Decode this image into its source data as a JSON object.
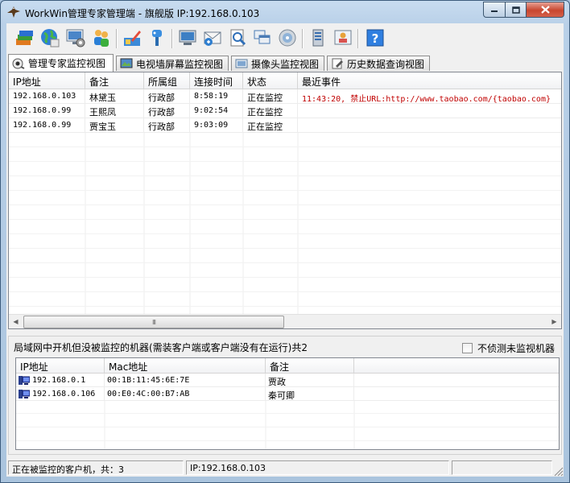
{
  "window": {
    "title": "WorkWin管理专家管理端 - 旗舰版 IP:192.168.0.103",
    "minimize_icon": "minimize-icon",
    "maximize_icon": "maximize-icon",
    "close_icon": "close-icon"
  },
  "toolbar": {
    "buttons": [
      {
        "icon": "stack-icon"
      },
      {
        "icon": "globe-icon"
      },
      {
        "icon": "screen-settings-icon"
      },
      {
        "icon": "users-icon"
      },
      {
        "icon": "pen-edit-icon"
      },
      {
        "icon": "pin-icon"
      },
      {
        "icon": "monitor-icon"
      },
      {
        "icon": "mail-icon"
      },
      {
        "icon": "search-doc-icon"
      },
      {
        "icon": "windows-icon"
      },
      {
        "icon": "disc-icon"
      },
      {
        "icon": "server-icon"
      },
      {
        "icon": "user-card-icon"
      },
      {
        "icon": "help-icon"
      }
    ]
  },
  "tabs": [
    {
      "label": "管理专家监控视图",
      "icon": "monitor-eye-icon",
      "active": true
    },
    {
      "label": "电视墙屏幕监控视图",
      "icon": "tv-wall-icon",
      "active": false
    },
    {
      "label": "摄像头监控视图",
      "icon": "camera-icon",
      "active": false
    },
    {
      "label": "历史数据查询视图",
      "icon": "history-icon",
      "active": false
    }
  ],
  "monitor_table": {
    "columns": [
      "IP地址",
      "备注",
      "所属组",
      "连接时间",
      "状态",
      "最近事件"
    ],
    "rows": [
      {
        "ip": "192.168.0.103",
        "note": "林黛玉",
        "group": "行政部",
        "time": "8:58:19",
        "status": "正在监控",
        "event": "11:43:20, 禁止URL:http://www.taobao.com/{taobao.com}"
      },
      {
        "ip": "192.168.0.99",
        "note": "王熙凤",
        "group": "行政部",
        "time": "9:02:54",
        "status": "正在监控",
        "event": ""
      },
      {
        "ip": "192.168.0.99",
        "note": "贾宝玉",
        "group": "行政部",
        "time": "9:03:09",
        "status": "正在监控",
        "event": ""
      }
    ],
    "scroll_thumb_grip": "III",
    "event_color": "#c00000"
  },
  "unmonitored": {
    "label": "局域网中开机但没被监控的机器(需装客户端或客户端没有在运行)共2",
    "checkbox_label": "不侦测未监视机器",
    "checkbox_checked": false,
    "columns": [
      "IP地址",
      "Mac地址",
      "备注"
    ],
    "rows": [
      {
        "ip": "192.168.0.1",
        "mac": "00:1B:11:45:6E:7E",
        "note": "贾政"
      },
      {
        "ip": "192.168.0.106",
        "mac": "00:E0:4C:00:B7:AB",
        "note": "秦可卿"
      }
    ]
  },
  "status": {
    "clients": "正在被监控的客户机，共：3",
    "ip": "IP:192.168.0.103"
  }
}
